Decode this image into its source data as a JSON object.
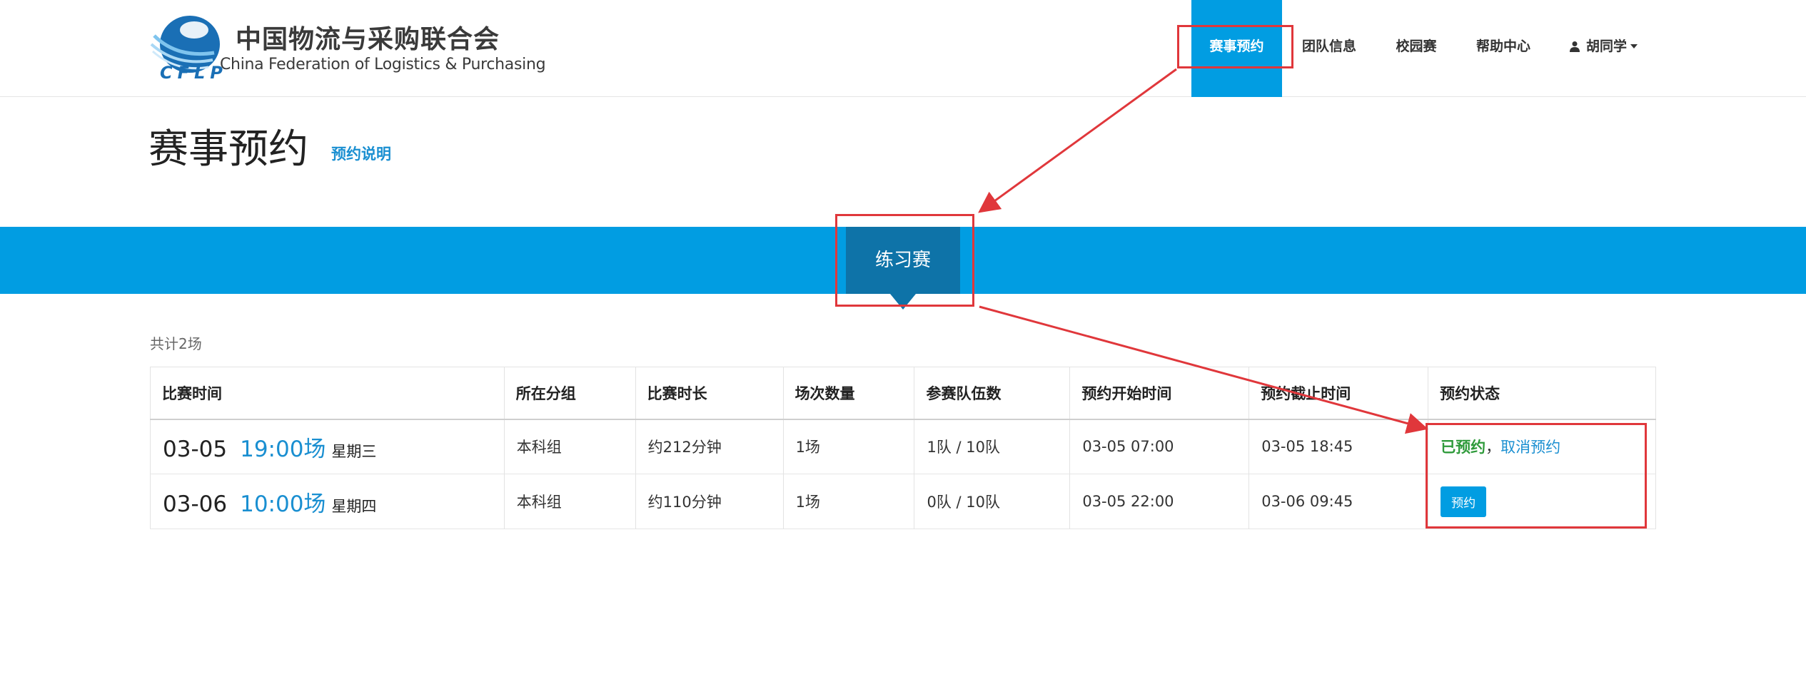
{
  "header": {
    "logo": {
      "cn": "中国物流与采购联合会",
      "en": "China Federation of Logistics & Purchasing",
      "abbr": "CFLP",
      "brand_color": "#1a6fb5"
    },
    "nav": [
      {
        "label": "赛事预约",
        "active": true
      },
      {
        "label": "团队信息",
        "active": false
      },
      {
        "label": "校园赛",
        "active": false
      },
      {
        "label": "帮助中心",
        "active": false
      }
    ],
    "user": {
      "name": "胡同学",
      "icon": "user-icon"
    }
  },
  "page": {
    "title": "赛事预约",
    "info_link": "预约说明"
  },
  "band": {
    "tab_label": "练习赛",
    "accent_color": "#019de2"
  },
  "count_text": "共计2场",
  "table": {
    "columns": [
      "比赛时间",
      "所在分组",
      "比赛时长",
      "场次数量",
      "参赛队伍数",
      "预约开始时间",
      "预约截止时间",
      "预约状态"
    ],
    "rows": [
      {
        "date": "03-05",
        "time": "19:00场",
        "weekday": "星期三",
        "group": "本科组",
        "duration": "约212分钟",
        "sessions": "1场",
        "teams": "1队 / 10队",
        "start": "03-05 07:00",
        "deadline": "03-05 18:45",
        "status_booked": "已预约",
        "status_sep": "，",
        "status_cancel": "取消预约"
      },
      {
        "date": "03-06",
        "time": "10:00场",
        "weekday": "星期四",
        "group": "本科组",
        "duration": "约110分钟",
        "sessions": "1场",
        "teams": "0队 / 10队",
        "start": "03-05 22:00",
        "deadline": "03-06 09:45",
        "reserve_label": "预约"
      }
    ]
  },
  "annotation_color": "#e0373b"
}
